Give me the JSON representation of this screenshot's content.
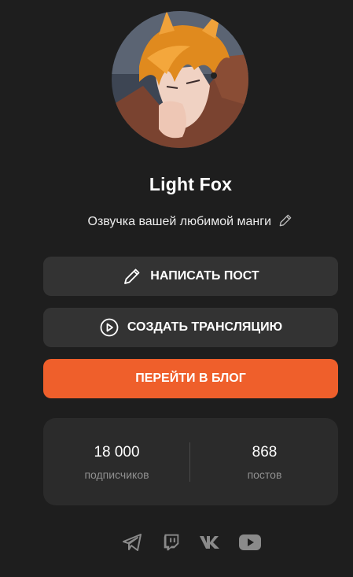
{
  "profile": {
    "username": "Light Fox",
    "bio": "Озвучка вашей любимой манги"
  },
  "actions": {
    "write_post": "НАПИСАТЬ ПОСТ",
    "create_stream": "СОЗДАТЬ ТРАНСЛЯЦИЮ",
    "go_to_blog": "ПЕРЕЙТИ В БЛОГ"
  },
  "stats": {
    "subscribers_count": "18 000",
    "subscribers_label": "подписчиков",
    "posts_count": "868",
    "posts_label": "постов"
  },
  "socials": [
    "telegram-icon",
    "twitch-icon",
    "vk-icon",
    "youtube-icon"
  ],
  "colors": {
    "background": "#1e1e1e",
    "button_dark": "#333333",
    "accent": "#ef5f2b",
    "stats_bg": "#2b2b2b",
    "muted_text": "#8f8f8f",
    "icon_gray": "#8a8a8a"
  }
}
